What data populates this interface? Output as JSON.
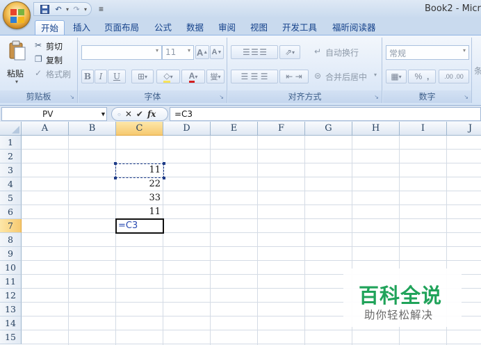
{
  "title_bar": {
    "app_title": "Book2 - Micr",
    "qat_customize": "≡"
  },
  "tabs": [
    "开始",
    "插入",
    "页面布局",
    "公式",
    "数据",
    "审阅",
    "视图",
    "开发工具",
    "福昕阅读器"
  ],
  "active_tab": "开始",
  "ribbon": {
    "clipboard": {
      "paste": "粘贴",
      "cut": "剪切",
      "copy": "复制",
      "format_painter": "格式刷",
      "label": "剪贴板"
    },
    "font": {
      "font_size": "11",
      "grow": "A",
      "shrink": "A",
      "bold": "B",
      "italic": "I",
      "underline": "U",
      "label": "字体",
      "phonetic": "燮"
    },
    "alignment": {
      "wrap_text": "自动换行",
      "merge_center": "合并后居中",
      "label": "对齐方式"
    },
    "number": {
      "format": "常规",
      "percent": "%",
      "comma": ",",
      "inc_decimal": ".00",
      "dec_decimal": ".00",
      "label": "数字"
    },
    "cut_off_group": "条"
  },
  "formula_bar": {
    "name_box": "PV",
    "cancel": "✕",
    "enter": "✔",
    "fx": "fx",
    "formula": "=C3"
  },
  "sheet": {
    "columns": [
      "A",
      "B",
      "C",
      "D",
      "E",
      "F",
      "G",
      "H",
      "I",
      "J"
    ],
    "selected_column": "C",
    "rows": [
      "1",
      "2",
      "3",
      "4",
      "5",
      "6",
      "7",
      "8",
      "9",
      "10",
      "11",
      "12",
      "13",
      "14",
      "15"
    ],
    "selected_row": "7",
    "cells": {
      "C3": "11",
      "C4": "22",
      "C5": "33",
      "C6": "11",
      "C7": "=C3"
    }
  },
  "watermark": {
    "main": "百科全说",
    "sub": "助你轻松解决"
  }
}
